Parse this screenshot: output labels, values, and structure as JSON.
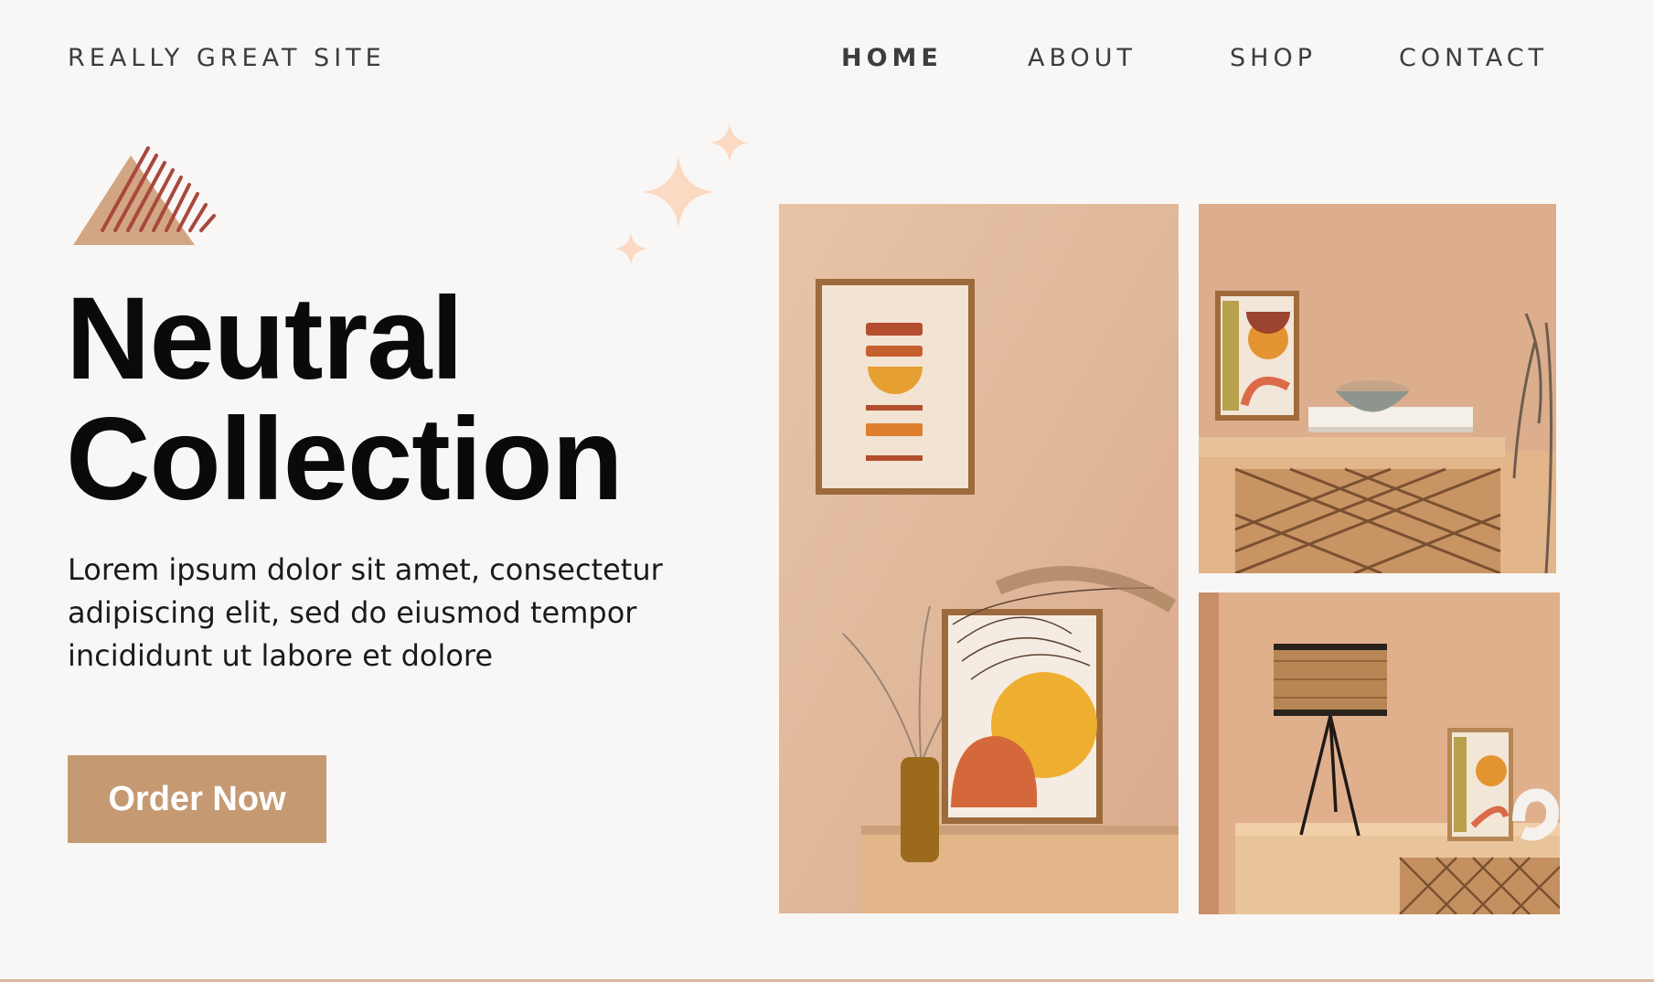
{
  "header": {
    "site_name": "REALLY GREAT SITE",
    "nav": [
      "HOME",
      "ABOUT",
      "SHOP",
      "CONTACT"
    ],
    "active_nav": "HOME"
  },
  "hero": {
    "headline_line1": "Neutral",
    "headline_line2": "Collection",
    "body": "Lorem ipsum dolor sit amet, consectetur adipiscing elit, sed do eiusmod tempor incididunt ut labore et dolore",
    "cta_label": "Order Now"
  },
  "colors": {
    "background": "#f9f7f6",
    "accent": "#c59a73",
    "logo_triangle": "#d2a682",
    "logo_stripes": "#a8483e",
    "sparkle": "#fbd9c3",
    "text": "#0a0a0a"
  },
  "icons": [
    "triangle-logo-icon",
    "sparkle-icon"
  ],
  "gallery": [
    {
      "name": "abstract-art-frames-photo"
    },
    {
      "name": "shelf-bowl-photo"
    },
    {
      "name": "rattan-lamp-photo"
    }
  ]
}
